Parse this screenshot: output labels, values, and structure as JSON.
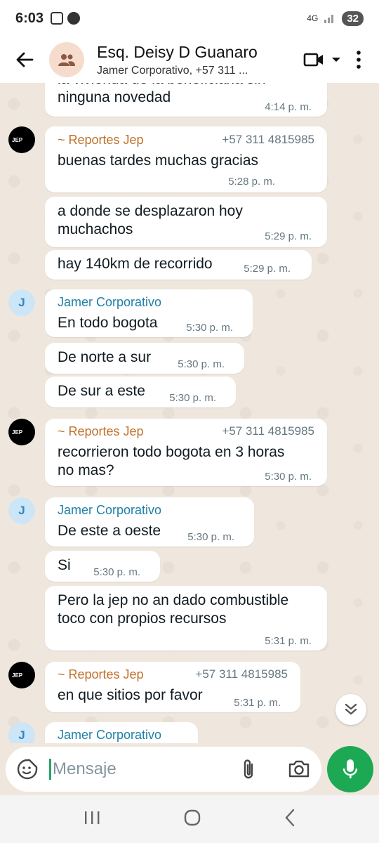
{
  "status_bar": {
    "time": "6:03",
    "network": "4G",
    "battery": "32"
  },
  "header": {
    "title": "Esq. Deisy D Guanaro",
    "subtitle": "Jamer Corporativo, +57 311 ...",
    "avatar_icon": "group-icon"
  },
  "messages": [
    {
      "text": "la vivienda de la beneficiaria sin ninguna novedad",
      "partial_top": "la vivienda de la beneficiaria sin",
      "partial_bottom": "ninguna novedad",
      "time": "4:14 p. m."
    },
    {
      "sender": "~ Reportes Jep",
      "phone": "+57 311 4815985",
      "text": "buenas tardes muchas gracias",
      "time": "5:28 p. m."
    },
    {
      "text_line1": "a donde se desplazaron hoy",
      "text_line2": "muchachos",
      "time": "5:29 p. m."
    },
    {
      "text": "hay 140km de recorrido",
      "time": "5:29 p. m."
    },
    {
      "sender": "Jamer Corporativo",
      "text": "En todo bogota",
      "time": "5:30 p. m.",
      "avatar_letter": "J"
    },
    {
      "text": "De norte a sur",
      "time": "5:30 p. m."
    },
    {
      "text": "De sur a este",
      "time": "5:30 p. m."
    },
    {
      "sender": "~ Reportes Jep",
      "phone": "+57 311 4815985",
      "text_line1": "recorrieron todo bogota en 3 horas",
      "text_line2": "no mas?",
      "time": "5:30 p. m."
    },
    {
      "sender": "Jamer Corporativo",
      "text": "De este a oeste",
      "time": "5:30 p. m.",
      "avatar_letter": "J"
    },
    {
      "text": "Si",
      "time": "5:30 p. m."
    },
    {
      "text_line1": "Pero la jep no an dado combustible",
      "text_line2": "toco con propios recursos",
      "time": "5:31 p. m."
    },
    {
      "sender": "~ Reportes Jep",
      "phone": "+57 311 4815985",
      "text": "en que sitios por favor",
      "time": "5:31 p. m."
    },
    {
      "sender": "Jamer Corporativo",
      "avatar_letter": "J"
    }
  ],
  "jep_avatar_text": "JEP",
  "input": {
    "placeholder": "Mensaje"
  },
  "colors": {
    "accent_green": "#1da854",
    "chat_bg": "#efe7dd",
    "sender_orange": "#c0702a",
    "sender_blue": "#1d7fa5"
  }
}
